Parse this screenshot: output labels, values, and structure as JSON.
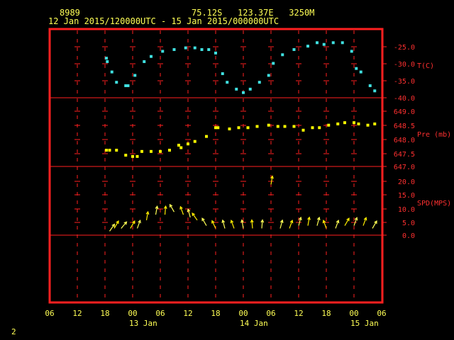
{
  "header": {
    "station": "8989",
    "location": "75.12S   123.37E   3250M",
    "period": "12 Jan 2015/120000UTC - 15 Jan 2015/000000UTC"
  },
  "footer": {
    "page_number": "2"
  },
  "colors": {
    "frame": "#ff2020",
    "grid": "#ff2020",
    "temperature": "#40e0e0",
    "pressure": "#ffff00",
    "wind": "#ffff55",
    "wind_alt": "#ffee00",
    "text": "#ffff55",
    "axis_text": "#ff3030"
  },
  "chart_data": [
    {
      "type": "scatter",
      "ylabel": "T(C)",
      "ylim": [
        -40.0,
        -22.5
      ],
      "yticks": [
        "-25.0",
        "-30.0",
        "-35.0",
        "-40.0"
      ],
      "x": [
        12.3,
        12.5,
        13.5,
        14.5,
        16.5,
        17,
        18.5,
        20.5,
        22,
        24.5,
        27,
        29.5,
        31.5,
        33,
        34.5,
        36,
        37.5,
        38.5,
        40.5,
        42,
        43.5,
        45.5,
        47.5,
        48.5,
        50.5,
        53,
        56,
        58,
        59.5,
        61.5,
        63.5,
        65.5,
        66.5,
        67.5,
        69.5,
        70.5
      ],
      "y": [
        -28.5,
        -29.5,
        -32.5,
        -35.5,
        -36.5,
        -36.5,
        -33.5,
        -29.5,
        -28,
        -26.5,
        -26,
        -25.5,
        -25.5,
        -26,
        -26,
        -27,
        -33,
        -35.5,
        -37.5,
        -38.5,
        -37.5,
        -35.5,
        -33.5,
        -30,
        -27.5,
        -26,
        -25,
        -24,
        -24.5,
        -24,
        -24,
        -26.5,
        -31.5,
        -32.5,
        -36.5,
        -38
      ]
    },
    {
      "type": "scatter",
      "ylabel": "Pre (mb)",
      "ylim": [
        646.9,
        649.25
      ],
      "yticks": [
        "649.0",
        "648.5",
        "648.0",
        "647.5",
        "647.0"
      ],
      "x": [
        12.3,
        13,
        14.5,
        16.5,
        18,
        19,
        20,
        22,
        24,
        26,
        28,
        28.5,
        30,
        31.5,
        34,
        36,
        36.5,
        39,
        41,
        43,
        45,
        47.5,
        49.5,
        51,
        53,
        55,
        57,
        58.5,
        60.5,
        62.5,
        64,
        66,
        67,
        69,
        70.5
      ],
      "y": [
        647.55,
        647.55,
        647.55,
        647.35,
        647.3,
        647.3,
        647.5,
        647.5,
        647.5,
        647.55,
        647.75,
        647.65,
        647.8,
        647.9,
        648.1,
        648.45,
        648.45,
        648.4,
        648.45,
        648.45,
        648.5,
        648.55,
        648.5,
        648.5,
        648.5,
        648.35,
        648.45,
        648.45,
        648.55,
        648.6,
        648.65,
        648.65,
        648.6,
        648.55,
        648.6
      ]
    },
    {
      "type": "scatter",
      "ylabel": "SPD(MPS)",
      "ylim": [
        0,
        25
      ],
      "yticks": [
        "20.0",
        "15.0",
        "10.0",
        "5.0",
        "0.0"
      ],
      "x": [
        13,
        14,
        15.5,
        17.5,
        19,
        21,
        23,
        25,
        27,
        29,
        30.5,
        32,
        34,
        36,
        38,
        40,
        42,
        44,
        46,
        48,
        50,
        52,
        54,
        56,
        58,
        60,
        62,
        64,
        66,
        68,
        70
      ],
      "y": [
        3,
        4,
        4,
        4,
        4,
        7,
        9,
        9,
        10,
        9,
        8,
        7,
        5,
        4,
        4,
        4,
        4,
        4,
        4,
        20,
        4,
        4,
        5,
        5,
        5,
        4,
        4,
        5,
        5,
        5,
        4
      ],
      "direction_deg": [
        35,
        30,
        40,
        30,
        20,
        10,
        10,
        5,
        330,
        340,
        345,
        325,
        330,
        335,
        345,
        340,
        350,
        355,
        5,
        10,
        15,
        20,
        15,
        10,
        15,
        340,
        20,
        30,
        20,
        20,
        30
      ]
    }
  ],
  "x_axis": {
    "hours_range": [
      0,
      72
    ],
    "tick_labels": [
      "06",
      "12",
      "18",
      "00",
      "06",
      "12",
      "18",
      "00",
      "06",
      "12",
      "18",
      "00",
      "06"
    ],
    "day_labels": [
      "13 Jan",
      "14 Jan",
      "15 Jan"
    ]
  }
}
